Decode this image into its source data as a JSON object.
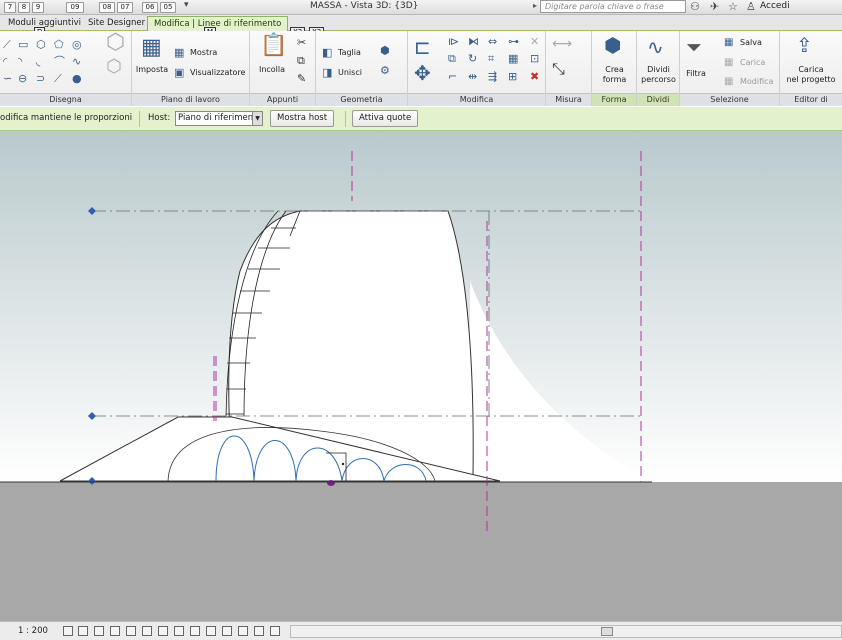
{
  "window": {
    "title": "MASSA - Vista 3D: {3D}",
    "search_placeholder": "Digitare parola chiave o frase",
    "login_label": "Accedi"
  },
  "quick_access_keytips": [
    "7",
    "8",
    "9",
    "09",
    "08",
    "07",
    "06",
    "05"
  ],
  "keytips": {
    "d": "D",
    "m": "M",
    "x2": "X2",
    "x3": "X3"
  },
  "tabs": [
    {
      "label": "Moduli aggiuntivi",
      "active": false
    },
    {
      "label": "Site Designer",
      "active": false
    },
    {
      "label": "Modifica | Linee di riferimento",
      "active": true
    }
  ],
  "ribbon": {
    "panels": {
      "disegna": "Disegna",
      "piano_di_lavoro": "Piano di lavoro",
      "appunti": "Appunti",
      "geometria": "Geometria",
      "modifica": "Modifica",
      "misura": "Misura",
      "forma": "Forma",
      "dividi": "Dividi",
      "selezione": "Selezione",
      "editor": "Editor di"
    },
    "buttons": {
      "imposta": "Imposta",
      "mostra": "Mostra",
      "visualizzatore": "Visualizzatore",
      "incolla": "Incolla",
      "taglia": "Taglia",
      "unisci": "Unisci",
      "crea_forma_1": "Crea",
      "crea_forma_2": "forma",
      "dividi_percorso_1": "Dividi",
      "dividi_percorso_2": "percorso",
      "filtra": "Filtra",
      "salva": "Salva",
      "carica": "Carica",
      "modifica": "Modifica",
      "carica_progetto_1": "Carica",
      "carica_progetto_2": "nel progetto"
    }
  },
  "options_bar": {
    "constraint_label": "odifica mantiene le proporzioni",
    "host_label": "Host:",
    "host_value": "Piano di riferimen",
    "show_host_button": "Mostra host",
    "activate_dims_button": "Attiva quote"
  },
  "status_bar": {
    "scale": "1 : 200"
  },
  "colors": {
    "active_tab_bg": "#e3f2cc",
    "ref_line": "#b0359a",
    "curve_blue": "#2f6fb0",
    "sky_top": "#b9c9cc",
    "ground": "#a8a8a8"
  }
}
